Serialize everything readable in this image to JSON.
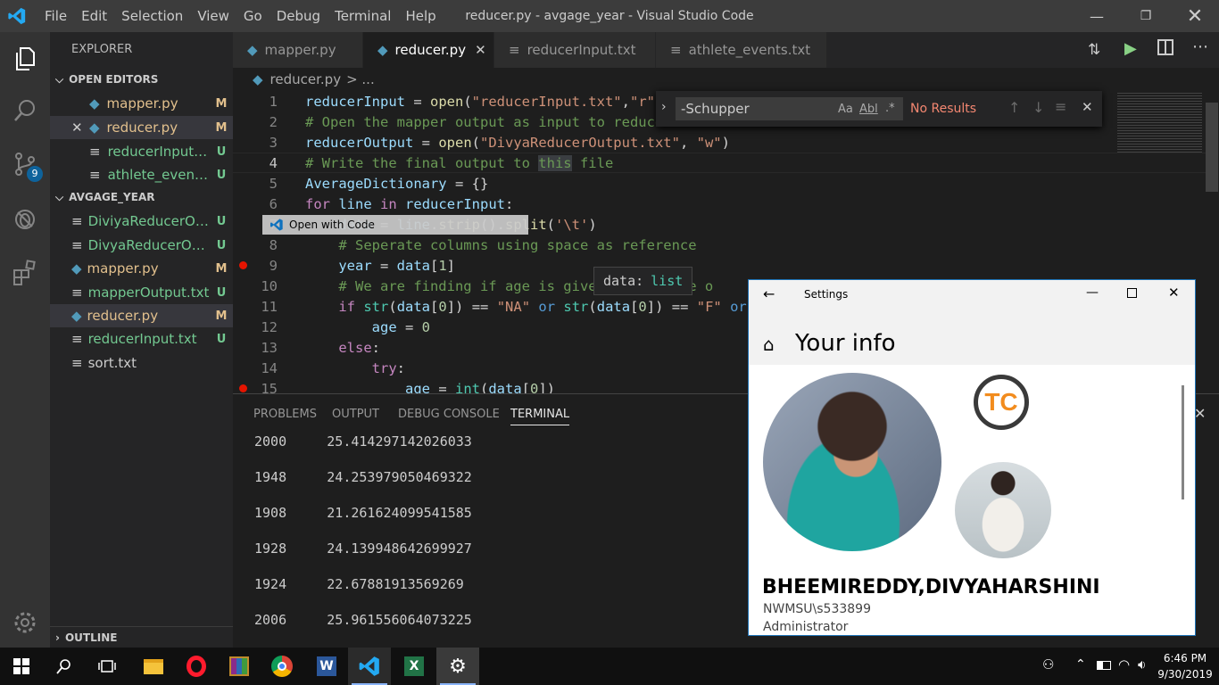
{
  "window": {
    "title": "reducer.py - avgage_year - Visual Studio Code"
  },
  "menu": [
    "File",
    "Edit",
    "Selection",
    "View",
    "Go",
    "Debug",
    "Terminal",
    "Help"
  ],
  "activity": {
    "badge": "9"
  },
  "sidebar": {
    "explorer_label": "EXPLORER",
    "open_editors_label": "OPEN EDITORS",
    "open_editors": [
      {
        "name": "mapper.py",
        "status": "M"
      },
      {
        "name": "reducer.py",
        "status": "M"
      },
      {
        "name": "reducerInput....",
        "status": "U"
      },
      {
        "name": "athlete_event...",
        "status": "U"
      }
    ],
    "folder_label": "AVGAGE_YEAR",
    "files": [
      {
        "name": "DiviyaReducerOu...",
        "status": "U"
      },
      {
        "name": "DivyaReducerOut...",
        "status": "U"
      },
      {
        "name": "mapper.py",
        "status": "M"
      },
      {
        "name": "mapperOutput.txt",
        "status": "U"
      },
      {
        "name": "reducer.py",
        "status": "M"
      },
      {
        "name": "reducerInput.txt",
        "status": "U"
      },
      {
        "name": "sort.txt",
        "status": ""
      }
    ],
    "outline_label": "OUTLINE"
  },
  "tabs": [
    "mapper.py",
    "reducer.py",
    "reducerInput.txt",
    "athlete_events.txt"
  ],
  "breadcrumb": {
    "file": "reducer.py",
    "rest": "> ..."
  },
  "find": {
    "value": "-Schupper",
    "case": "Aa",
    "word": "Abl",
    "regex": ".*",
    "result": "No Results"
  },
  "tooltip_open_with": "Open with Code",
  "hover": {
    "name": "data:",
    "type": "list"
  },
  "line_numbers": [
    "1",
    "2",
    "3",
    "4",
    "5",
    "6",
    "7",
    "8",
    "9",
    "10",
    "11",
    "12",
    "13",
    "14",
    "15"
  ],
  "panel": {
    "tabs": [
      "PROBLEMS",
      "OUTPUT",
      "DEBUG CONSOLE",
      "TERMINAL"
    ],
    "rows": [
      {
        "year": "2000",
        "value": "25.414297142026033"
      },
      {
        "year": "1948",
        "value": "24.253979050469322"
      },
      {
        "year": "1908",
        "value": "21.26162409954158​5"
      },
      {
        "year": "1928",
        "value": "24.139948642699927"
      },
      {
        "year": "1924",
        "value": "22.67881913569269"
      },
      {
        "year": "2006",
        "value": "25.961556064073225"
      }
    ]
  },
  "settings": {
    "title": "Settings",
    "heading": "Your info",
    "name": "BHEEMIREDDY,DIVYAHARSHINI",
    "account": "NWMSU\\s533899",
    "role": "Administrator",
    "logo_text": "TC"
  },
  "clock": {
    "time": "6:46 PM",
    "date": "9/30/2019"
  }
}
